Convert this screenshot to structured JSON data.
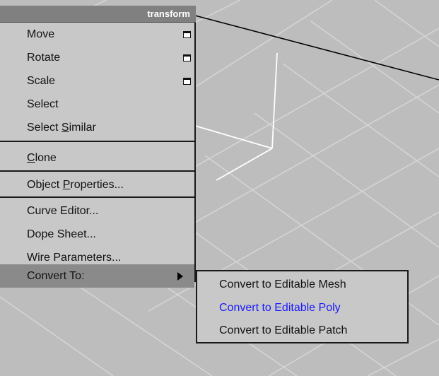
{
  "menu": {
    "title": "transform",
    "items": [
      {
        "label": "Move",
        "icon": "window-box-icon"
      },
      {
        "label": "Rotate",
        "icon": "window-box-icon"
      },
      {
        "label": "Scale",
        "icon": "window-box-icon"
      },
      {
        "label": "Select"
      },
      {
        "label_pre": "Select ",
        "label_ul": "S",
        "label_post": "imilar"
      },
      {
        "label_pre": "",
        "label_ul": "C",
        "label_post": "lone"
      },
      {
        "label_pre": "Object ",
        "label_ul": "P",
        "label_post": "roperties..."
      },
      {
        "label": "Curve Editor..."
      },
      {
        "label": "Dope Sheet..."
      },
      {
        "label": "Wire Parameters..."
      },
      {
        "label": "Convert To:",
        "icon": "submenu-arrow-icon",
        "highlighted": true
      }
    ]
  },
  "submenu": {
    "items": [
      {
        "label": "Convert to Editable Mesh"
      },
      {
        "label": "Convert to Editable Poly",
        "highlighted": true
      },
      {
        "label": "Convert to Editable Patch"
      }
    ]
  },
  "colors": {
    "viewport_bg": "#bdbdbd",
    "grid_line": "#d8d8d8",
    "menu_bg": "#c8c8c8",
    "title_bg": "#808080",
    "highlight_bg": "#8a8a8a",
    "highlight_text": "#1a1aff",
    "gizmo": "#ffffff"
  }
}
